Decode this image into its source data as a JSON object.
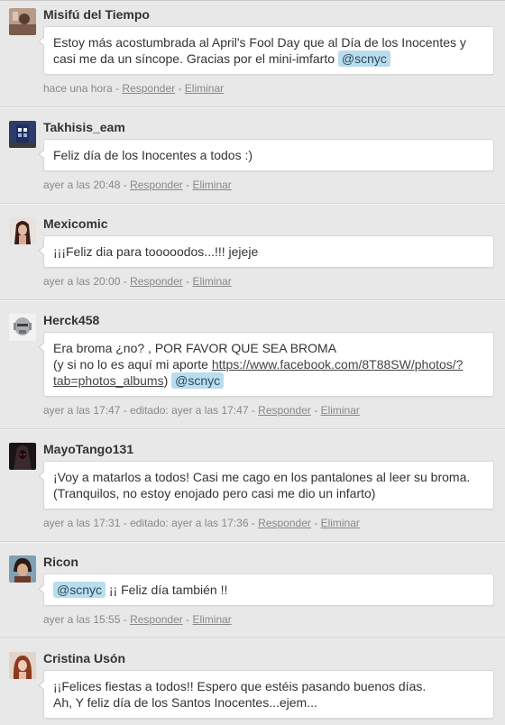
{
  "separator": " - ",
  "comments": [
    {
      "author": "Misifú del Tiempo",
      "text": "Estoy más acostumbrada al April's Fool Day que al Día de los Inocentes y casi me da un síncope. Gracias por el mini-imfarto",
      "mention": "@scnyc",
      "time": "hace una hora",
      "reply": "Responder",
      "delete": "Eliminar"
    },
    {
      "author": "Takhisis_eam",
      "text": "Feliz día de los Inocentes a todos :)",
      "time": "ayer a las 20:48",
      "reply": "Responder",
      "delete": "Eliminar"
    },
    {
      "author": "Mexicomic",
      "text": "¡¡¡Feliz dia para tooooodos...!!! jejeje",
      "time": "ayer a las 20:00",
      "reply": "Responder",
      "delete": "Eliminar"
    },
    {
      "author": "Herck458",
      "text_line1": "Era broma ¿no? , POR FAVOR QUE SEA BROMA",
      "text_line2": "(y si no lo es aquí mi aporte ",
      "link1": "https://www.facebook.com/8T88SW/photos/?",
      "link2": "tab=photos_albums",
      "close": ")",
      "mention": "@scnyc",
      "time": "ayer a las 17:47",
      "edited": "editado: ayer a las 17:47",
      "reply": "Responder",
      "delete": "Eliminar"
    },
    {
      "author": "MayoTango131",
      "text_line1": "¡Voy a matarlos a todos! Casi me cago en los pantalones al leer su broma.",
      "text_line2": "(Tranquilos, no estoy enojado pero casi me dio un infarto)",
      "time": "ayer a las 17:31",
      "edited": "editado: ayer a las 17:36",
      "reply": "Responder",
      "delete": "Eliminar"
    },
    {
      "author": "Ricon",
      "mention": "@scnyc",
      "text": " ¡¡ Feliz día también !!",
      "time": "ayer a las 15:55",
      "reply": "Responder",
      "delete": "Eliminar"
    },
    {
      "author": "Cristina Usón",
      "text_line1": "¡¡Felices fiestas a todos!! Espero que estéis pasando buenos días.",
      "text_line2": "Ah, Y feliz día de los Santos Inocentes...ejem..."
    }
  ]
}
